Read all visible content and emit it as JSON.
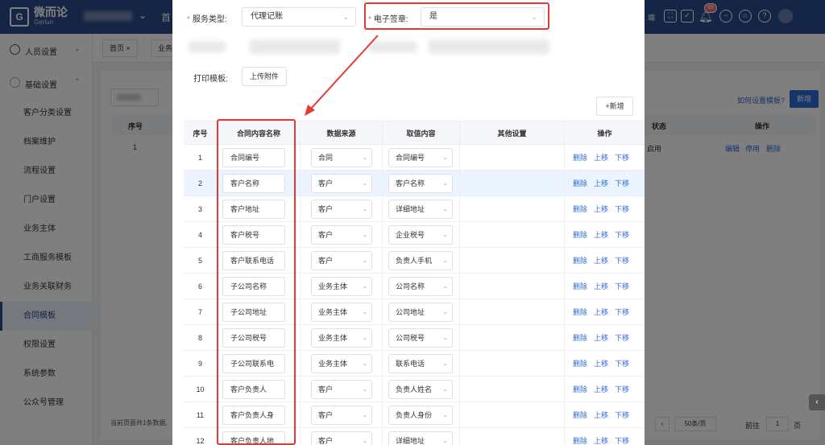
{
  "header": {
    "logo_mark": "G",
    "brand_name": "微而论",
    "brand_sub": "Gerlun",
    "home": "首",
    "tool_label": "端",
    "notification_count": "99"
  },
  "sidebar": {
    "groups": [
      {
        "label": "人员设置"
      },
      {
        "label": "基础设置"
      }
    ],
    "items": [
      {
        "label": "客户分类设置"
      },
      {
        "label": "档案维护"
      },
      {
        "label": "流程设置"
      },
      {
        "label": "门户设置"
      },
      {
        "label": "业务主体"
      },
      {
        "label": "工商服务模板"
      },
      {
        "label": "业务关联财务"
      },
      {
        "label": "合同模板"
      },
      {
        "label": "权限设置"
      },
      {
        "label": "系统参数"
      },
      {
        "label": "公众号管理"
      }
    ]
  },
  "tabs": [
    {
      "label": "首页 ×"
    },
    {
      "label": "业务"
    }
  ],
  "background": {
    "help_link": "如何设置模板?",
    "new_button": "新增",
    "col_index": "序号",
    "col_status": "状态",
    "col_action": "操作",
    "row_index": "1",
    "row_status": "启用",
    "act_edit": "编辑",
    "act_disable": "停用",
    "act_delete": "删除",
    "footer": "当前页面共1条数据,",
    "page_size": "50条/页",
    "goto_label": "前往",
    "goto_value": "1",
    "page_unit": "页"
  },
  "modal": {
    "service_type_label": "服务类型:",
    "service_type_value": "代理记账",
    "esign_label": "电子签章:",
    "esign_value": "是",
    "print_template_label": "打印模板:",
    "upload_button": "上传附件",
    "add_button": "+新增",
    "columns": [
      "序号",
      "合同内容名称",
      "数据来源",
      "取值内容",
      "其他设置",
      "操作"
    ],
    "actions": {
      "delete": "删除",
      "up": "上移",
      "down": "下移"
    },
    "rows": [
      {
        "index": "1",
        "name": "合同编号",
        "source": "合同",
        "value": "合同编号"
      },
      {
        "index": "2",
        "name": "客户名称",
        "source": "客户",
        "value": "客户名称"
      },
      {
        "index": "3",
        "name": "客户地址",
        "source": "客户",
        "value": "详细地址"
      },
      {
        "index": "4",
        "name": "客户税号",
        "source": "客户",
        "value": "企业税号"
      },
      {
        "index": "5",
        "name": "客户联系电话",
        "source": "客户",
        "value": "负责人手机"
      },
      {
        "index": "6",
        "name": "子公司名称",
        "source": "业务主体",
        "value": "公司名称"
      },
      {
        "index": "7",
        "name": "子公司地址",
        "source": "业务主体",
        "value": "公司地址"
      },
      {
        "index": "8",
        "name": "子公司税号",
        "source": "业务主体",
        "value": "公司税号"
      },
      {
        "index": "9",
        "name": "子公司联系电",
        "source": "业务主体",
        "value": "联系电话"
      },
      {
        "index": "10",
        "name": "客户负责人",
        "source": "客户",
        "value": "负责人姓名"
      },
      {
        "index": "11",
        "name": "客户负责人身",
        "source": "客户",
        "value": "负责人身份"
      },
      {
        "index": "12",
        "name": "客户负责人地",
        "source": "客户",
        "value": "详细地址"
      }
    ]
  },
  "colors": {
    "brand": "#2b4a8b",
    "link": "#2b6bd6",
    "annotation": "#e53935",
    "row_highlight": "#ecf5ff"
  }
}
